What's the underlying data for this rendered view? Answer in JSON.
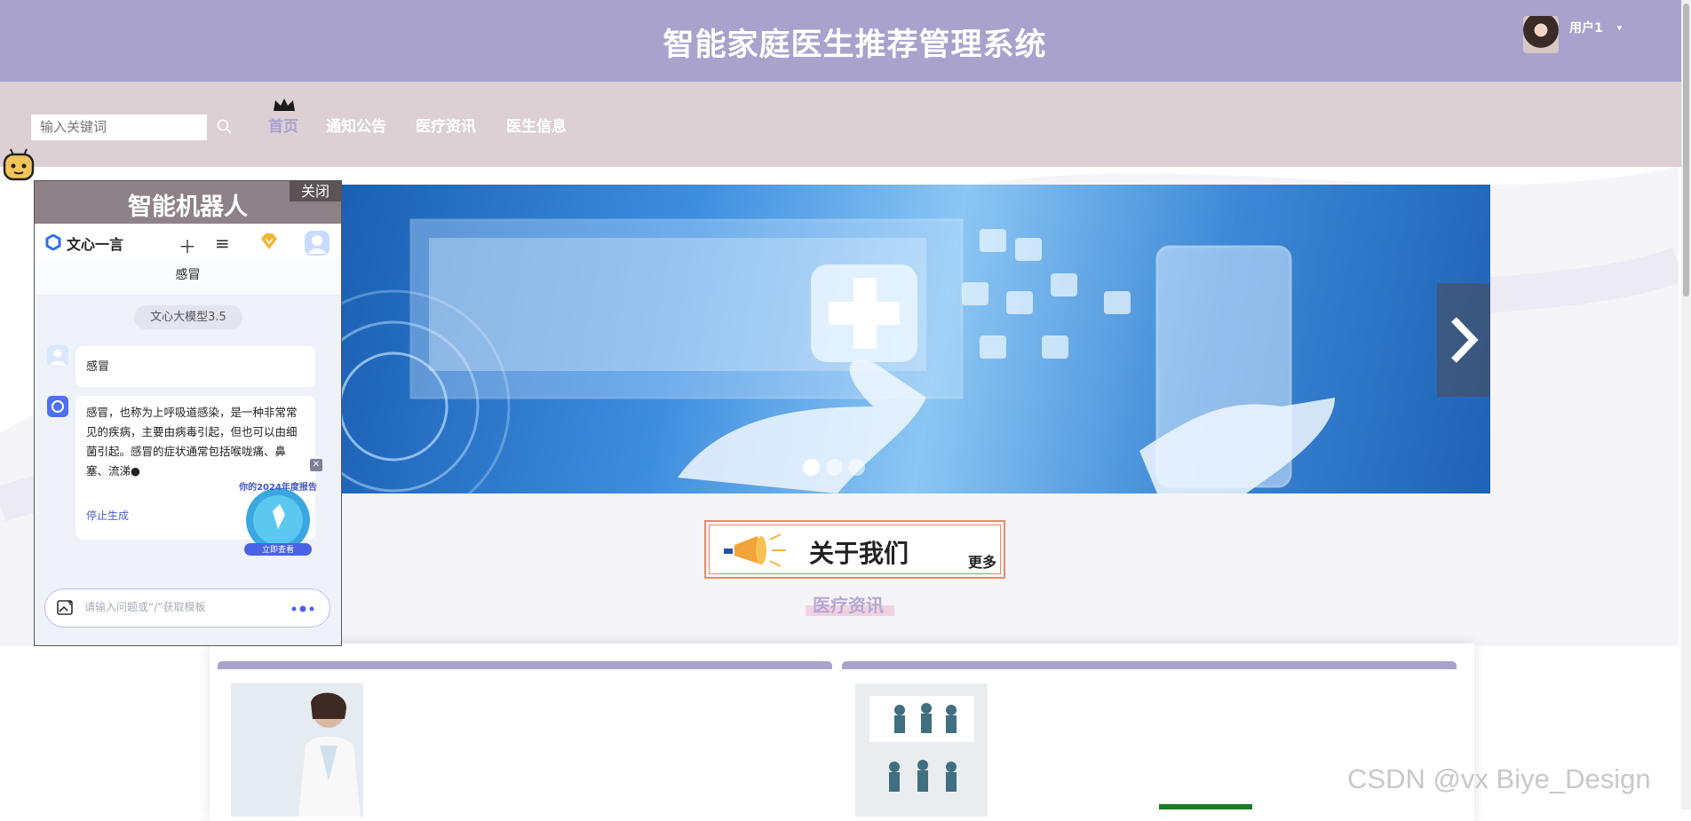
{
  "header": {
    "title": "智能家庭医生推荐管理系统",
    "user_name": "用户1",
    "caret": "▾"
  },
  "nav": {
    "search_placeholder": "输入关键词",
    "items": [
      {
        "label": "首页",
        "active": true
      },
      {
        "label": "通知公告",
        "active": false
      },
      {
        "label": "医疗资讯",
        "active": false
      },
      {
        "label": "医生信息",
        "active": false
      }
    ]
  },
  "banner": {
    "slides": 3,
    "active_slide": 1
  },
  "about": {
    "title": "关于我们",
    "more": "更多"
  },
  "section": {
    "title": "医疗资讯"
  },
  "chat": {
    "panel_title": "智能机器人",
    "close_label": "关闭",
    "brand_name": "文心一言",
    "conversation_title": "感冒",
    "model_label": "文心大模型3.5",
    "user_message": "感冒",
    "bot_message": "感冒，也称为上呼吸道感染，是一种非常常见的疾病，主要由病毒引起，但也可以由细菌引起。感冒的症状通常包括喉咙痛、鼻塞、流涕●",
    "stop_label": "停止生成",
    "promo_text": "你的2024年度报告",
    "promo_button": "立即查看",
    "input_placeholder": "请输入问题或“/”获取模板"
  },
  "watermark": "CSDN @vx Biye_Design",
  "colors": {
    "header": "#a9a2cd",
    "nav": "#dcd0d4",
    "active_nav": "#a9a2cd",
    "about_border": "#e88b6a"
  },
  "icons": [
    "search-icon",
    "crown-icon",
    "chevron-right-icon",
    "megaphone-icon",
    "robot-icon",
    "plus-icon",
    "menu-icon",
    "gem-icon",
    "image-upload-icon",
    "voice-icon"
  ]
}
